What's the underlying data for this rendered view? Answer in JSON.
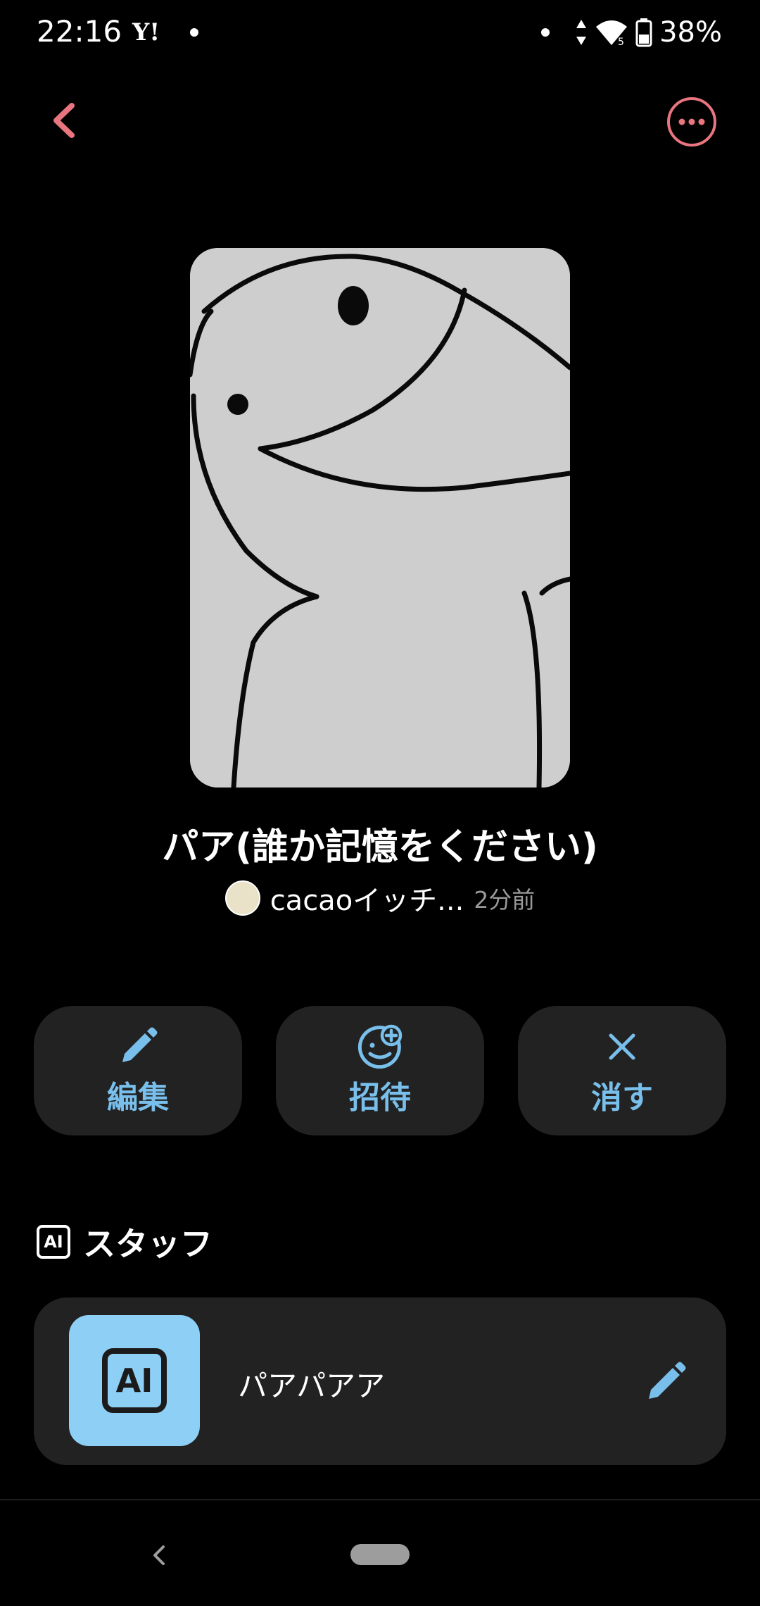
{
  "status_bar": {
    "time": "22:16",
    "yahoo": "Y!",
    "battery": "38%",
    "network_badge": "5"
  },
  "story": {
    "title": "パア(誰か記憶をください)",
    "author": "cacaoイッチ...",
    "time_ago": "2分前"
  },
  "actions": [
    {
      "label": "編集",
      "icon": "pencil-icon"
    },
    {
      "label": "招待",
      "icon": "add-person-icon"
    },
    {
      "label": "消す",
      "icon": "close-icon"
    }
  ],
  "staff": {
    "header_badge": "AI",
    "header": "スタッフ",
    "member": {
      "avatar_text": "AI",
      "name": "パアパアア"
    }
  },
  "colors": {
    "accent_pink": "#e8757f",
    "accent_blue": "#79bfec",
    "card_bg": "#222222",
    "ai_avatar_bg": "#8ed0f5"
  }
}
